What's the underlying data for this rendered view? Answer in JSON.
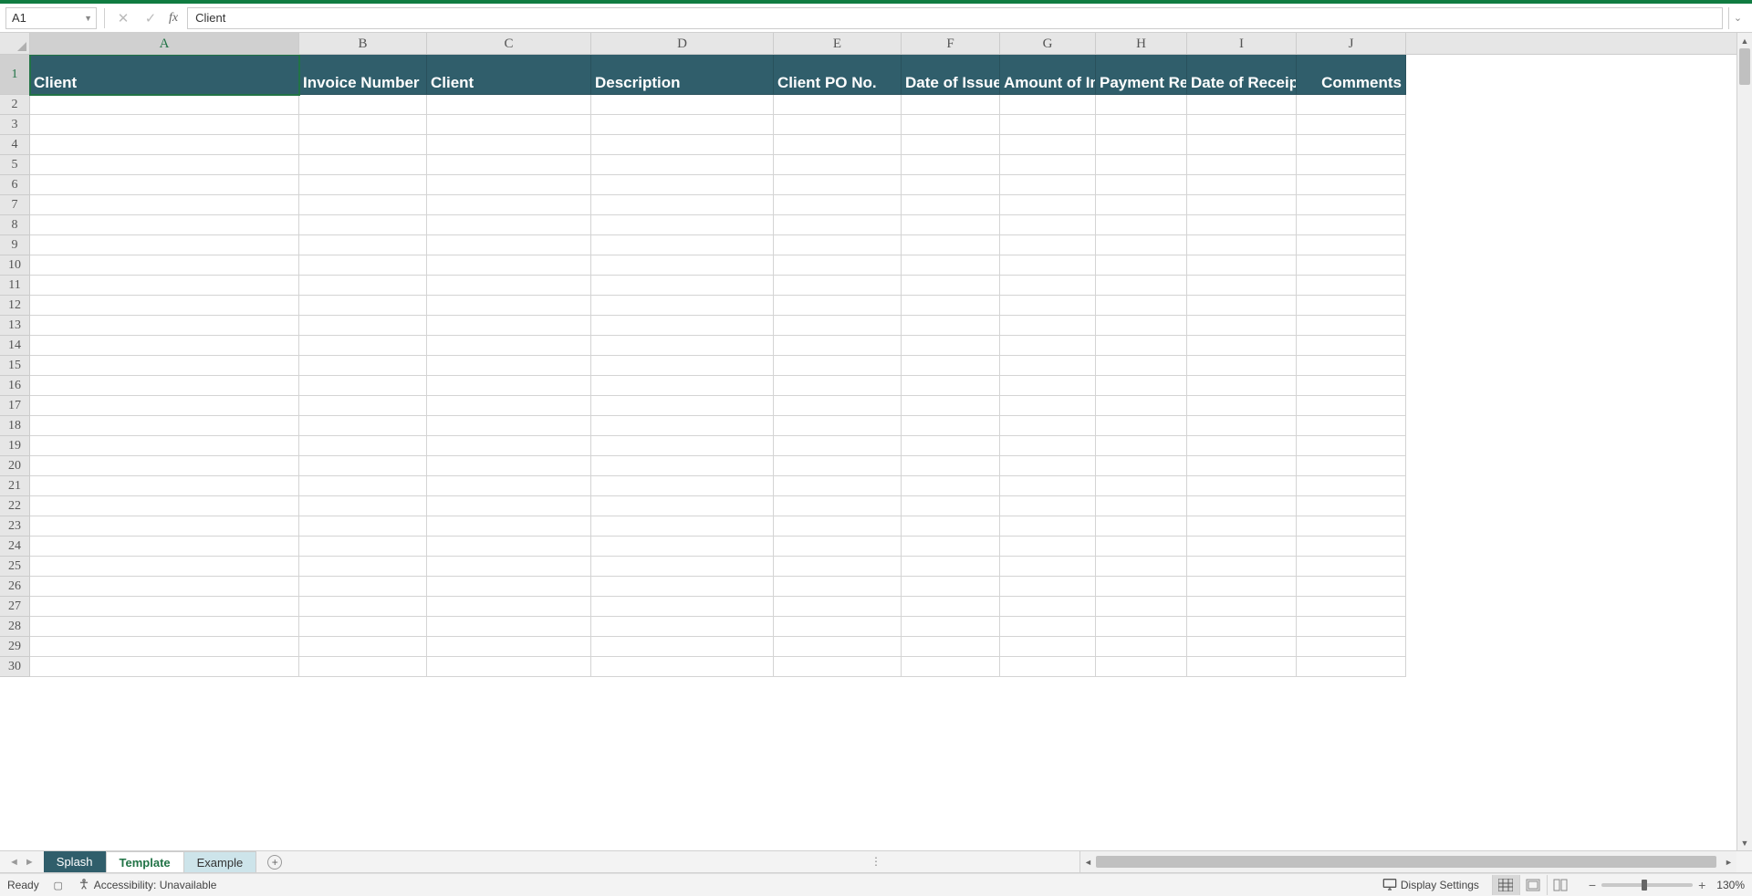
{
  "nameBox": "A1",
  "formula": "Client",
  "columns": [
    "A",
    "B",
    "C",
    "D",
    "E",
    "F",
    "G",
    "H",
    "I",
    "J"
  ],
  "selectedColumn": "A",
  "selectedRow": 1,
  "headerCells": {
    "A": "Client",
    "B": "Invoice Number",
    "C": "Client",
    "D": "Description",
    "E": "Client PO No.",
    "F": "Date of Issue",
    "G": "Amount of Invoice",
    "H": "Payment Received",
    "I": "Date of Receipt",
    "J": "Comments"
  },
  "rightAligned": [
    "J"
  ],
  "rowCount": 30,
  "sheetTabs": {
    "splash": "Splash",
    "template": "Template",
    "example": "Example"
  },
  "status": {
    "ready": "Ready",
    "accessibility": "Accessibility: Unavailable",
    "displaySettings": "Display Settings",
    "zoom": "130%"
  }
}
